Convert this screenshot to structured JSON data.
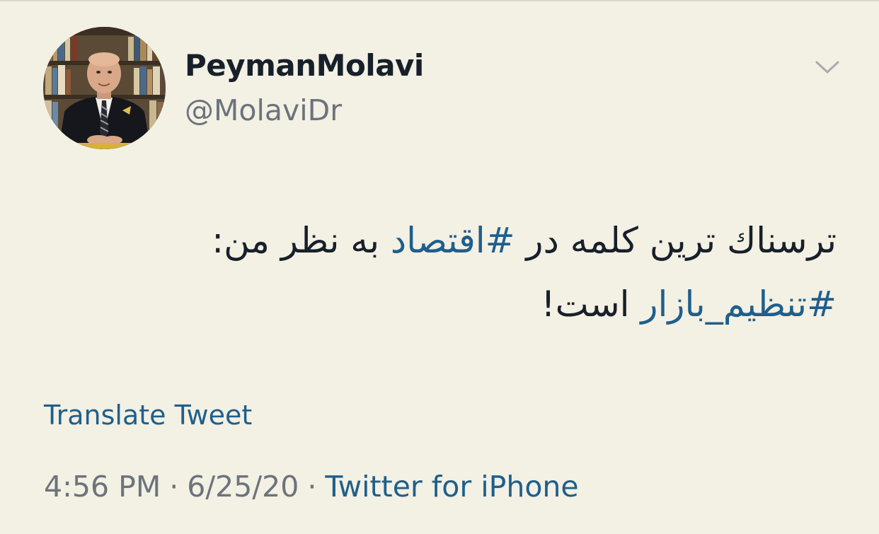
{
  "tweet": {
    "author": {
      "display_name": "PeymanMolavi",
      "handle": "@MolaviDr"
    },
    "menu_icon": "chevron-down-icon",
    "text": {
      "line1_prefix": "ترسناك ترين كلمه در ",
      "hashtag1": "#اقتصاد",
      "line1_suffix": " به نظر من:",
      "hashtag2": "#تنظيم_بازار",
      "line2_suffix": " است!"
    },
    "translate_label": "Translate Tweet",
    "meta": {
      "time": "4:56 PM",
      "separator": "·",
      "date": "6/25/20",
      "source": "Twitter for iPhone"
    }
  },
  "colors": {
    "background": "#f3f0e4",
    "text": "#17202a",
    "secondary": "#6c737b",
    "link": "#1f5f8b"
  }
}
